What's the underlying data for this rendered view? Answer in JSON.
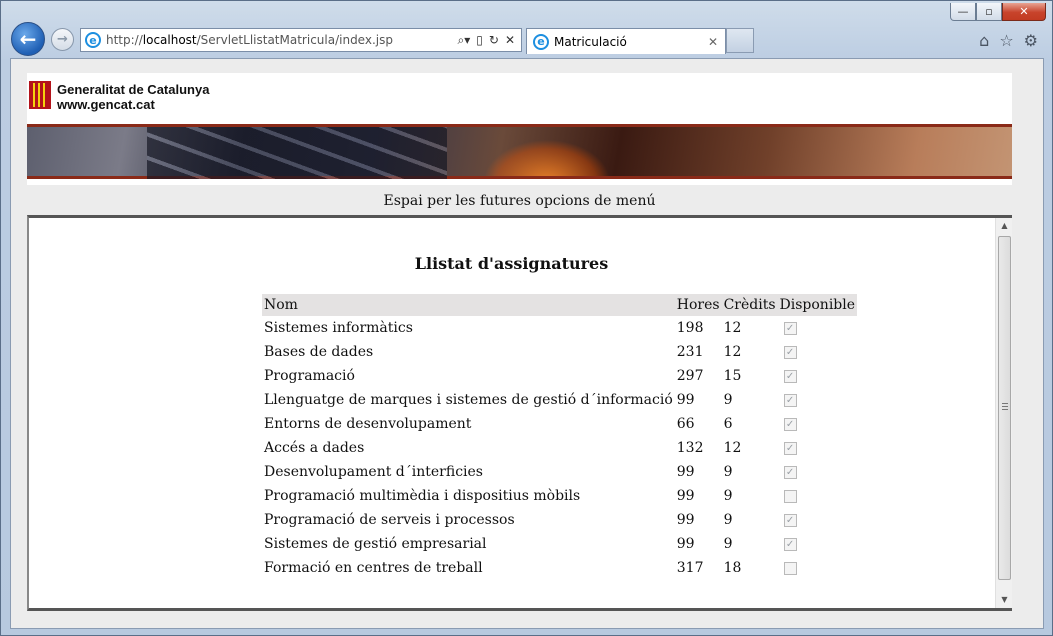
{
  "browser": {
    "address": {
      "prefix": "http://",
      "host": "localhost",
      "path": "/ServletLlistatMatricula/index.jsp"
    },
    "tab": {
      "title": "Matriculació"
    },
    "window_controls": {
      "minimize": "—",
      "maximize": "▫",
      "close": "✕"
    }
  },
  "page": {
    "banner": {
      "org_name": "Generalitat de Catalunya",
      "org_url": "www.gencat.cat"
    },
    "menu_placeholder": "Espai per les futures opcions de menú",
    "title": "Llistat d'assignatures",
    "table": {
      "headers": [
        "Nom",
        "Hores",
        "Crèdits",
        "Disponible"
      ],
      "rows": [
        {
          "nom": "Sistemes informàtics",
          "hores": "198",
          "credits": "12",
          "disponible": true
        },
        {
          "nom": "Bases de dades",
          "hores": "231",
          "credits": "12",
          "disponible": true
        },
        {
          "nom": "Programació",
          "hores": "297",
          "credits": "15",
          "disponible": true
        },
        {
          "nom": "Llenguatge de marques i sistemes de gestió d´informació",
          "hores": "99",
          "credits": "9",
          "disponible": true
        },
        {
          "nom": "Entorns de desenvolupament",
          "hores": "66",
          "credits": "6",
          "disponible": true
        },
        {
          "nom": "Accés a dades",
          "hores": "132",
          "credits": "12",
          "disponible": true
        },
        {
          "nom": "Desenvolupament d´interficies",
          "hores": "99",
          "credits": "9",
          "disponible": true
        },
        {
          "nom": "Programació multimèdia i dispositius mòbils",
          "hores": "99",
          "credits": "9",
          "disponible": false
        },
        {
          "nom": "Programació de serveis i processos",
          "hores": "99",
          "credits": "9",
          "disponible": true
        },
        {
          "nom": "Sistemes de gestió empresarial",
          "hores": "99",
          "credits": "9",
          "disponible": true
        },
        {
          "nom": "Formació en centres de treball",
          "hores": "317",
          "credits": "18",
          "disponible": false
        }
      ]
    }
  }
}
